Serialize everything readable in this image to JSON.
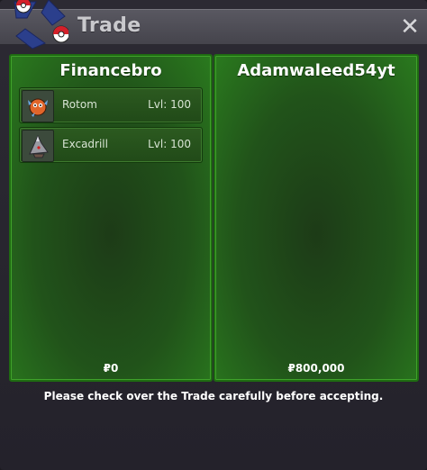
{
  "window": {
    "title": "Trade",
    "close_label": "✕"
  },
  "colors": {
    "panel_green": "#2a7a1e",
    "panel_border": "#1f6b12",
    "titlebar": "#4f4e57",
    "background": "#24222b"
  },
  "left_panel": {
    "player_name": "Financebro",
    "items": [
      {
        "name": "Rotom",
        "level": "Lvl: 100",
        "icon": "rotom-sprite-icon"
      },
      {
        "name": "Excadrill",
        "level": "Lvl: 100",
        "icon": "excadrill-sprite-icon"
      }
    ],
    "money": "₽0"
  },
  "right_panel": {
    "player_name": "Adamwaleed54yt",
    "items": [],
    "money": "₽800,000"
  },
  "footer": {
    "message": "Please check over the Trade carefully before accepting."
  }
}
